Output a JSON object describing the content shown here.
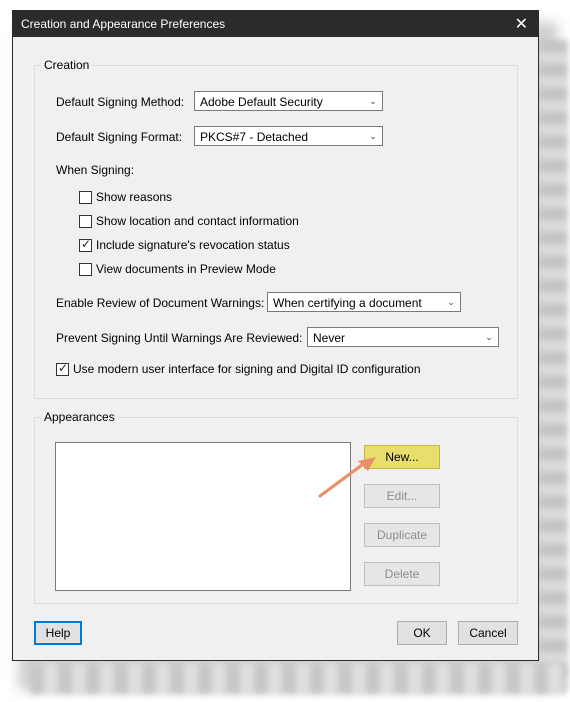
{
  "window": {
    "title": "Creation and Appearance Preferences"
  },
  "creation": {
    "group_label": "Creation",
    "default_signing_method": {
      "label": "Default Signing Method:",
      "value": "Adobe Default Security"
    },
    "default_signing_format": {
      "label": "Default Signing Format:",
      "value": "PKCS#7 - Detached"
    },
    "when_signing_label": "When Signing:",
    "options": [
      {
        "label": "Show reasons",
        "checked": false
      },
      {
        "label": "Show location and contact information",
        "checked": false
      },
      {
        "label": "Include signature's revocation status",
        "checked": true
      },
      {
        "label": "View documents in Preview Mode",
        "checked": false
      }
    ],
    "enable_review": {
      "label": "Enable Review of Document Warnings:",
      "value": "When certifying a document"
    },
    "prevent_signing": {
      "label": "Prevent Signing Until Warnings Are Reviewed:",
      "value": "Never"
    },
    "modern_ui": {
      "label": "Use modern user interface for signing and Digital ID configuration",
      "checked": true
    }
  },
  "appearances": {
    "group_label": "Appearances",
    "buttons": {
      "new": "New...",
      "edit": "Edit...",
      "duplicate": "Duplicate",
      "delete": "Delete"
    }
  },
  "footer": {
    "help": "Help",
    "ok": "OK",
    "cancel": "Cancel"
  },
  "icons": {
    "close": "close-icon",
    "dropdown": "chevron-down-icon",
    "checkmark": "checkmark-icon",
    "annotation": "arrow-annotation"
  },
  "colors": {
    "titlebar": "#2b2b2b",
    "highlight_button": "#e8de6e",
    "annotation_arrow": "#e8906a",
    "default_button_border": "#0078d7"
  }
}
